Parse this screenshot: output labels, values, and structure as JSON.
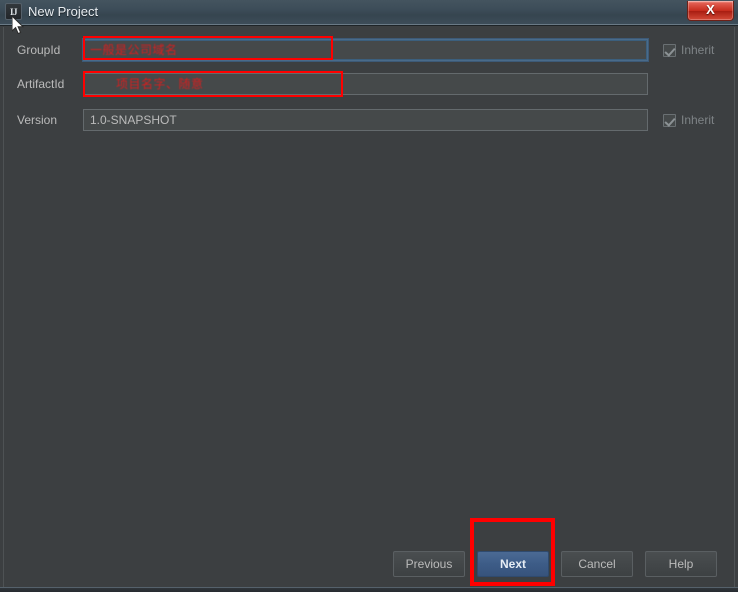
{
  "window": {
    "title": "New Project",
    "app_icon_text": "IJ",
    "close_label": "X",
    "titlebar_color": "#3c4c58",
    "panel_color": "#3c3f41"
  },
  "form": {
    "rows": [
      {
        "label": "GroupId",
        "value": "",
        "annotation": "一般是公司域名",
        "focused": true,
        "has_inherit": true,
        "inherit_label": "Inherit",
        "inherit_checked": true
      },
      {
        "label": "ArtifactId",
        "value": "",
        "annotation": "项目名字、随意",
        "focused": false,
        "has_inherit": false,
        "inherit_label": "",
        "inherit_checked": false
      },
      {
        "label": "Version",
        "value": "1.0-SNAPSHOT",
        "annotation": "",
        "focused": false,
        "has_inherit": true,
        "inherit_label": "Inherit",
        "inherit_checked": true
      }
    ]
  },
  "buttons": {
    "previous": "Previous",
    "next": "Next",
    "cancel": "Cancel",
    "help": "Help"
  },
  "annotations": {
    "accent_color": "#ff0000",
    "highlight_target": "Next"
  }
}
